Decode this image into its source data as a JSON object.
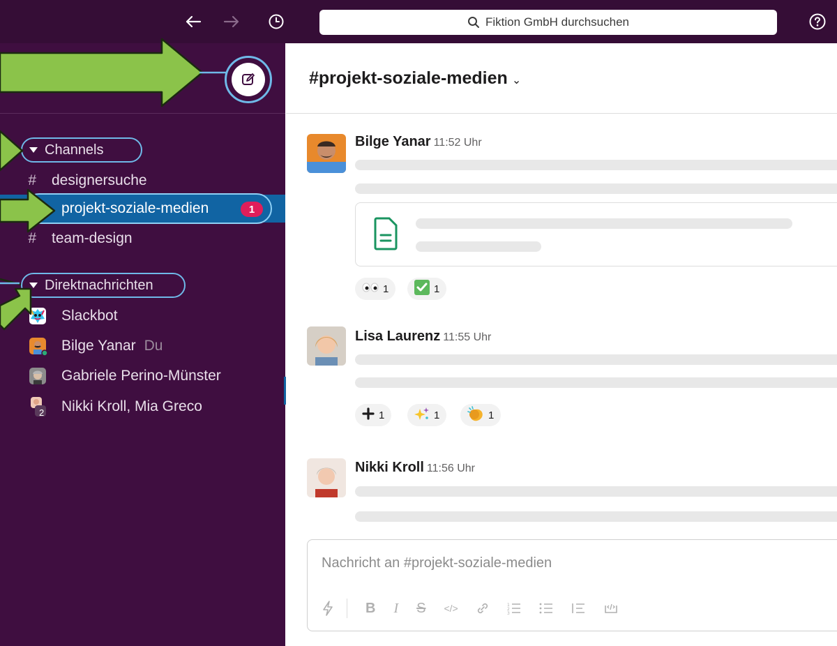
{
  "topbar": {
    "search_placeholder": "Fiktion GmbH durchsuchen",
    "back_icon": "arrow-left",
    "forward_icon": "arrow-right",
    "history_icon": "clock",
    "help_icon": "question-circle"
  },
  "sidebar": {
    "compose_icon": "pencil-square",
    "channels_header": "Channels",
    "channels": [
      {
        "label": "designersuche",
        "prefix": "#"
      },
      {
        "label": "projekt-soziale-medien",
        "prefix": "#",
        "active": true,
        "unread": "1"
      },
      {
        "label": "team-design",
        "prefix": "#"
      }
    ],
    "dm_header": "Direktnachrichten",
    "dms": [
      {
        "label": "Slackbot"
      },
      {
        "label": "Bilge Yanar",
        "suffix": "Du"
      },
      {
        "label": "Gabriele Perino-Münster"
      },
      {
        "label": "Nikki Kroll, Mia Greco",
        "group_count": "2"
      }
    ]
  },
  "main": {
    "channel_title": "#projekt-soziale-medien",
    "chevron": "⌄",
    "messages": [
      {
        "author": "Bilge Yanar",
        "time": "11:52 Uhr",
        "reactions": [
          {
            "emoji": "eyes",
            "count": "1"
          },
          {
            "emoji": "check-mark",
            "count": "1"
          }
        ]
      },
      {
        "author": "Lisa Laurenz",
        "time": "11:55 Uhr",
        "reactions": [
          {
            "emoji": "plus",
            "count": "1"
          },
          {
            "emoji": "sparkles",
            "count": "1"
          },
          {
            "emoji": "clap",
            "count": "1"
          }
        ]
      },
      {
        "author": "Nikki Kroll",
        "time": "11:56 Uhr"
      }
    ],
    "composer_placeholder": "Nachricht an #projekt-soziale-medien"
  },
  "colors": {
    "topbar": "#350d36",
    "sidebar": "#3f0e40",
    "active_channel": "#1164a3",
    "badge": "#e01e5a",
    "highlight_outline": "#6fb9e8",
    "annotation_arrow": "#8bc34a"
  }
}
